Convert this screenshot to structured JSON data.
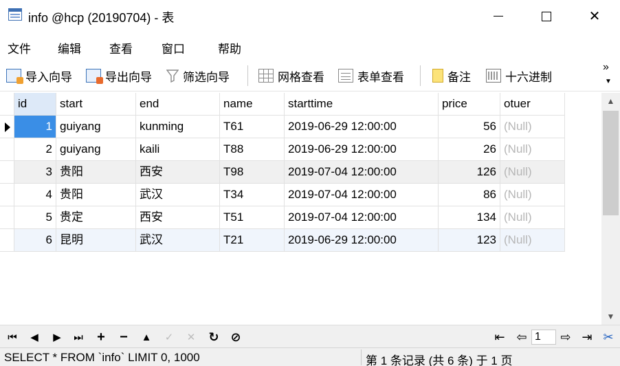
{
  "window": {
    "title": "info @hcp (20190704) - 表",
    "controls": {
      "minimize": "minimize-icon",
      "maximize": "maximize-icon",
      "close": "✕"
    }
  },
  "menu": [
    "文件",
    "编辑",
    "查看",
    "窗口",
    "帮助"
  ],
  "toolbar": {
    "import_wizard": "导入向导",
    "export_wizard": "导出向导",
    "filter_wizard": "筛选向导",
    "grid_view": "网格查看",
    "form_view": "表单查看",
    "memo": "备注",
    "hex": "十六进制",
    "overflow": "»"
  },
  "table": {
    "columns": [
      "id",
      "start",
      "end",
      "name",
      "starttime",
      "price",
      "otuer"
    ],
    "rows": [
      [
        "1",
        "guiyang",
        "kunming",
        "T61",
        "2019-06-29 12:00:00",
        "56",
        "(Null)"
      ],
      [
        "2",
        "guiyang",
        "kaili",
        "T88",
        "2019-06-29 12:00:00",
        "26",
        "(Null)"
      ],
      [
        "3",
        "贵阳",
        "西安",
        "T98",
        "2019-07-04 12:00:00",
        "126",
        "(Null)"
      ],
      [
        "4",
        "贵阳",
        "武汉",
        "T34",
        "2019-07-04 12:00:00",
        "86",
        "(Null)"
      ],
      [
        "5",
        "贵定",
        "西安",
        "T51",
        "2019-07-04 12:00:00",
        "134",
        "(Null)"
      ],
      [
        "6",
        "昆明",
        "武汉",
        "T21",
        "2019-06-29 12:00:00",
        "123",
        "(Null)"
      ]
    ]
  },
  "nav": {
    "first": "⏮",
    "prev": "◀",
    "next": "▶",
    "last": "⏭",
    "add": "+",
    "delete": "−",
    "up": "▲",
    "apply": "✓",
    "cancel": "✕",
    "refresh": "↻",
    "stop": "⊘",
    "page": "1",
    "page_first": "⇤",
    "page_prev": "⇦",
    "page_next": "⇨",
    "page_last": "⇥",
    "tools": "✂"
  },
  "status": {
    "sql": "SELECT * FROM `info` LIMIT 0, 1000",
    "record": "第 1 条记录 (共 6 条) 于 1 页"
  },
  "colors": {
    "selected_cell": "#3a8ee6",
    "header_selected": "#dde9f8",
    "alt_row": "#f0f0f0",
    "current_row": "#f0f5fc",
    "null_text": "#b6b6b6"
  }
}
